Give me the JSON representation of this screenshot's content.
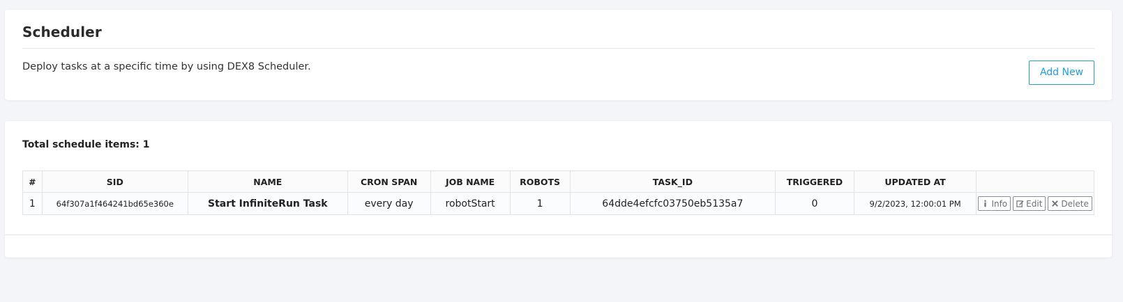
{
  "header": {
    "title": "Scheduler",
    "description": "Deploy tasks at a specific time by using DEX8 Scheduler.",
    "add_button": "Add New",
    "accent_color": "#1e9bea"
  },
  "list": {
    "total_label": "Total schedule items: 1",
    "columns": [
      "#",
      "SID",
      "NAME",
      "CRON SPAN",
      "JOB NAME",
      "ROBOTS",
      "TASK_ID",
      "TRIGGERED",
      "UPDATED AT",
      ""
    ],
    "rows": [
      {
        "num": "1",
        "sid": "64f307a1f464241bd65e360e",
        "name": "Start InfiniteRun Task",
        "cron_span": "every day",
        "job_name": "robotStart",
        "robots": "1",
        "task_id": "64dde4efcfc03750eb5135a7",
        "triggered": "0",
        "updated_at": "9/2/2023, 12:00:01 PM",
        "actions": {
          "info": "Info",
          "edit": "Edit",
          "delete": "Delete"
        }
      }
    ]
  },
  "icons": {
    "info": "info-icon",
    "edit": "edit-icon",
    "delete": "close-icon"
  }
}
